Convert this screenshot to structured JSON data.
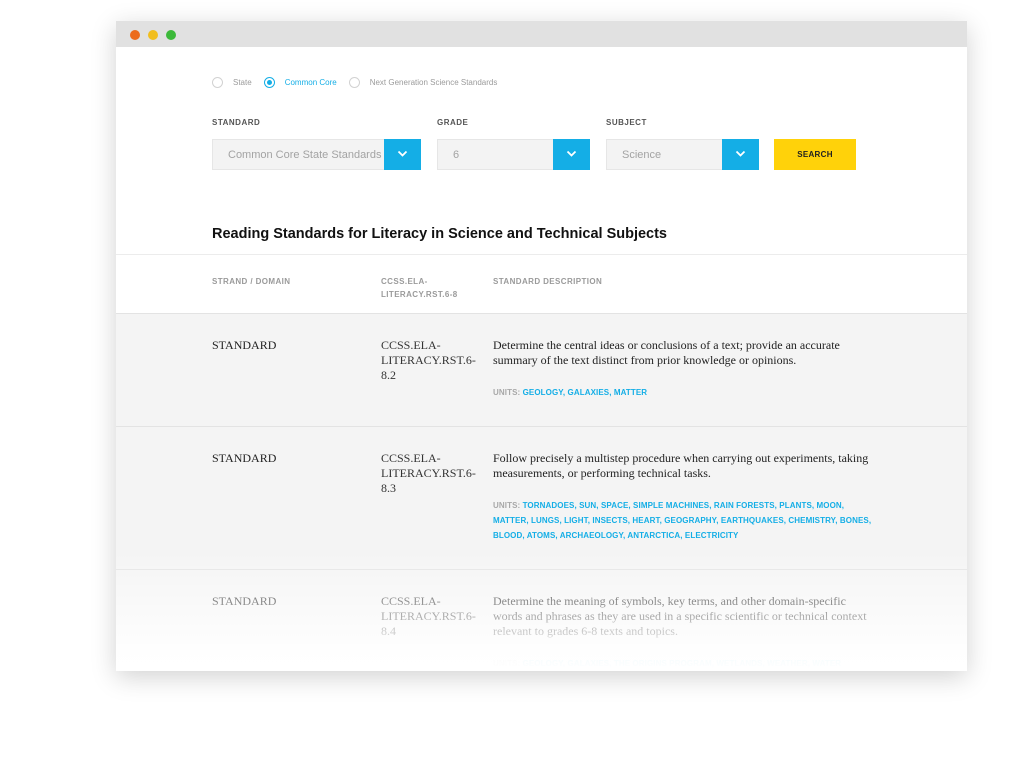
{
  "radios": [
    {
      "label": "State",
      "selected": false
    },
    {
      "label": "Common Core",
      "selected": true
    },
    {
      "label": "Next Generation Science Standards",
      "selected": false
    }
  ],
  "filters": {
    "standard": {
      "label": "STANDARD",
      "value": "Common Core State Standards"
    },
    "grade": {
      "label": "GRADE",
      "value": "6"
    },
    "subject": {
      "label": "SUBJECT",
      "value": "Science"
    },
    "search_label": "SEARCH"
  },
  "table": {
    "title": "Reading Standards for Literacy in Science and Technical Subjects",
    "headers": {
      "domain": "STRAND / DOMAIN",
      "code_line1": "CCSS.ELA-",
      "code_line2": "LITERACY.RST.6-8",
      "description": "STANDARD DESCRIPTION"
    },
    "units_label": "UNITS:",
    "rows": [
      {
        "domain": "STANDARD",
        "code_line1": "CCSS.ELA-",
        "code_line2": "LITERACY.RST.6-8.2",
        "description": "Determine the central ideas or conclusions of a text; provide an accurate summary of the text distinct from prior knowledge or opinions.",
        "units": "GEOLOGY, GALAXIES, MATTER"
      },
      {
        "domain": "STANDARD",
        "code_line1": "CCSS.ELA-",
        "code_line2": "LITERACY.RST.6-8.3",
        "description": "Follow precisely a multistep procedure when carrying out experiments, taking measurements, or performing technical tasks.",
        "units": "TORNADOES, SUN, SPACE, SIMPLE MACHINES, RAIN FORESTS, PLANTS, MOON, MATTER, LUNGS, LIGHT, INSECTS, HEART, GEOGRAPHY, EARTHQUAKES, CHEMISTRY, BONES, BLOOD, ATOMS, ARCHAEOLOGY, ANTARCTICA, ELECTRICITY"
      },
      {
        "domain": "STANDARD",
        "code_line1": "CCSS.ELA-",
        "code_line2": "LITERACY.RST.6-8.4",
        "description": "Determine the meaning of symbols, key terms, and other domain-specific words and phrases as they are used in a specific scientific or technical context relevant to grades 6-8 texts and topics.",
        "units": "GEOLOGY, GALAXIES, THE ORIGINS PROGRAM, WETLANDS, WEATHER, WATER"
      }
    ]
  }
}
